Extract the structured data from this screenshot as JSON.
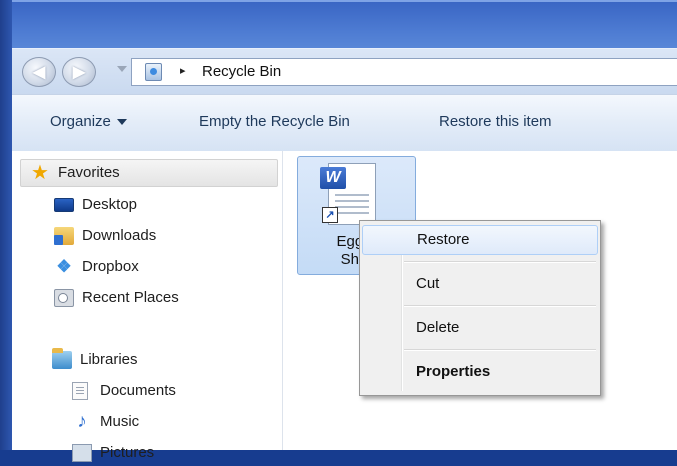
{
  "navigation": {
    "back_glyph": "◀",
    "forward_glyph": "▶",
    "address": {
      "icon": "recycle-bin-icon",
      "separator_glyph": "▸",
      "location": "Recycle Bin"
    }
  },
  "toolbar": {
    "organize": "Organize",
    "empty_bin": "Empty the Recycle Bin",
    "restore_item": "Restore this item"
  },
  "sidebar": {
    "favorites_header": "Favorites",
    "favorites": [
      {
        "label": "Desktop",
        "icon": "desktop-icon"
      },
      {
        "label": "Downloads",
        "icon": "downloads-folder-icon"
      },
      {
        "label": "Dropbox",
        "icon": "dropbox-icon"
      },
      {
        "label": "Recent Places",
        "icon": "recent-places-icon"
      }
    ],
    "libraries_header": "Libraries",
    "libraries": [
      {
        "label": "Documents",
        "icon": "documents-icon"
      },
      {
        "label": "Music",
        "icon": "music-icon"
      },
      {
        "label": "Pictures",
        "icon": "pictures-icon"
      }
    ]
  },
  "content": {
    "file": {
      "name_line1": "Eggra",
      "name_line2": "Shor",
      "icon": "word-document-shortcut-icon",
      "badge": "W",
      "shortcut_glyph": "↗"
    }
  },
  "context_menu": {
    "items": [
      {
        "label": "Restore",
        "highlighted": true
      },
      {
        "label": "Cut"
      },
      {
        "label": "Delete"
      },
      {
        "label": "Properties",
        "bold": true
      }
    ]
  },
  "colors": {
    "window_frame": "#173c8f",
    "toolbar_text": "#1e395b",
    "selection_fill": "#c4dbf6",
    "selection_border": "#84acdd",
    "menu_background": "#f0f0f0"
  }
}
